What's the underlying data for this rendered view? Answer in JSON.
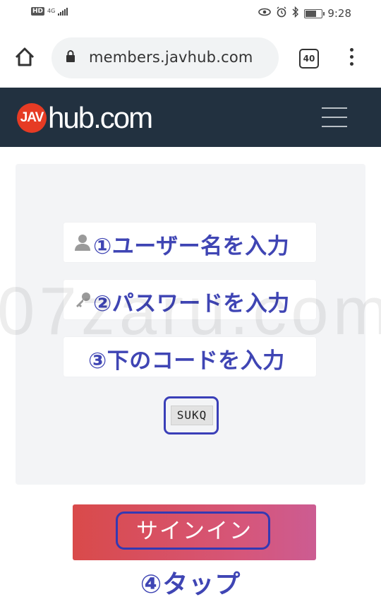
{
  "status_bar": {
    "hd": "HD",
    "network": "4G",
    "time": "9:28",
    "icons": [
      "eye-icon",
      "alarm-icon",
      "bluetooth-icon",
      "battery-icon"
    ]
  },
  "browser": {
    "url": "members.javhub.com",
    "tab_count": "40",
    "icons": [
      "home-icon",
      "lock-icon",
      "menu-dots-icon"
    ]
  },
  "site_header": {
    "logo_badge": "JAV",
    "logo_text": "hub.com",
    "background": "#223140"
  },
  "login_form": {
    "username_label": "①ユーザー名を入力",
    "password_label": "②パスワードを入力",
    "code_label": "③下のコードを入力",
    "captcha_code": "SUKQ",
    "annotation_color": "#3f45b4"
  },
  "sign_in": {
    "button_label": "サインイン",
    "tap_note": "④タップ"
  },
  "watermark": "07zaru.com"
}
